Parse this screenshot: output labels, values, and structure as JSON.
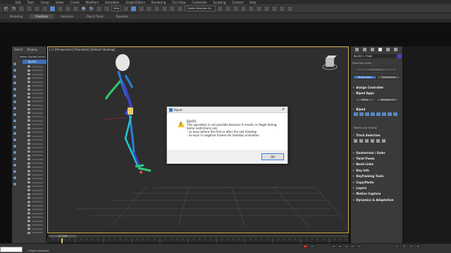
{
  "menu": [
    "Edit",
    "Tools",
    "Group",
    "Views",
    "Create",
    "Modifiers",
    "Animation",
    "Graph Editors",
    "Rendering",
    "Civil View",
    "Customize",
    "Scripting",
    "Content",
    "Help"
  ],
  "toolbar": {
    "view_dropdown": "View",
    "selection_set": "Create Selection Se"
  },
  "ribbon": {
    "tabs": [
      "Modeling",
      "Freeform",
      "Selection",
      "Object Paint",
      "Populate"
    ],
    "active_index": 1
  },
  "scene_explorer": {
    "tabs": [
      "Select",
      "Display"
    ],
    "header": "Name (Sorted Ascen",
    "selected_item": "Bip001"
  },
  "viewport": {
    "label": "[+] [Perspective] [Standard] [Default Shading]"
  },
  "command_panel": {
    "object_name": "Bip001 L Thigh",
    "object_color": "#3b44c8",
    "selection_level_label": "Selection Level:",
    "sub_object": "Sub-Object",
    "tabs": [
      "Parameters",
      "Trajectories"
    ],
    "assign_controller": "Assign Controller",
    "biped_apps": "Biped Apps",
    "mixer": "Mixer",
    "workbench": "Workbench",
    "biped": "Biped",
    "modes_display": "Modes and Display",
    "track_selection": "Track Selection",
    "rollouts": [
      "Quaternion / Euler",
      "Twist Poses",
      "Bend Links",
      "Key Info",
      "Keyframing Tools",
      "Copy/Paste",
      "Layers",
      "Motion Capture",
      "Dynamics & Adaptation"
    ]
  },
  "dialog": {
    "title": "Biped",
    "close": "✕",
    "lines": [
      "Bip001",
      "This operation is not possible because it results in illegal timing.",
      "Some restrictions are:",
      "- no keys before the first or after the last footstep",
      "- no keys in negative frames for footstep animation"
    ],
    "ok": "OK"
  },
  "timeline": {
    "slider": "0 / 449"
  },
  "status": {
    "text": "1 Object Selected"
  }
}
